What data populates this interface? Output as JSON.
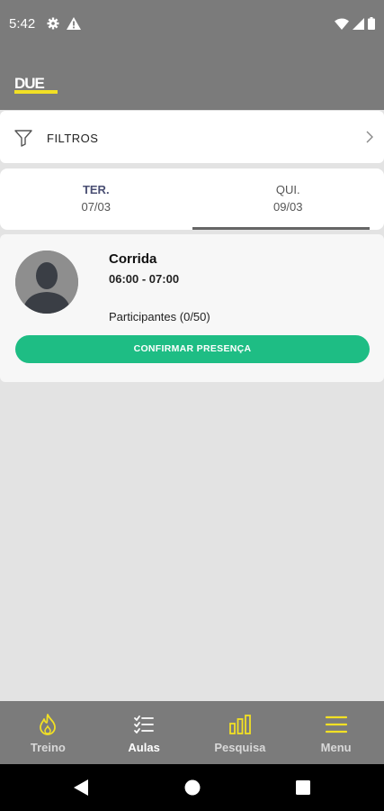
{
  "status_bar": {
    "time": "5:42"
  },
  "app": {
    "logo_text": "DUE"
  },
  "filters": {
    "label": "FILTROS"
  },
  "days": [
    {
      "name": "TER.",
      "date": "07/03"
    },
    {
      "name": "QUI.",
      "date": "09/03"
    }
  ],
  "class_card": {
    "title": "Corrida",
    "time": "06:00 - 07:00",
    "participants": "Participantes (0/50)",
    "confirm_label": "CONFIRMAR PRESENÇA"
  },
  "bottom_nav": {
    "items": [
      {
        "label": "Treino",
        "icon": "flame-icon"
      },
      {
        "label": "Aulas",
        "icon": "checklist-icon"
      },
      {
        "label": "Pesquisa",
        "icon": "bar-chart-icon"
      },
      {
        "label": "Menu",
        "icon": "hamburger-menu-icon"
      }
    ]
  },
  "colors": {
    "header": "#7b7b7b",
    "accent_green": "#1ebd84",
    "accent_yellow": "#f2e024",
    "background": "#e3e3e3"
  }
}
